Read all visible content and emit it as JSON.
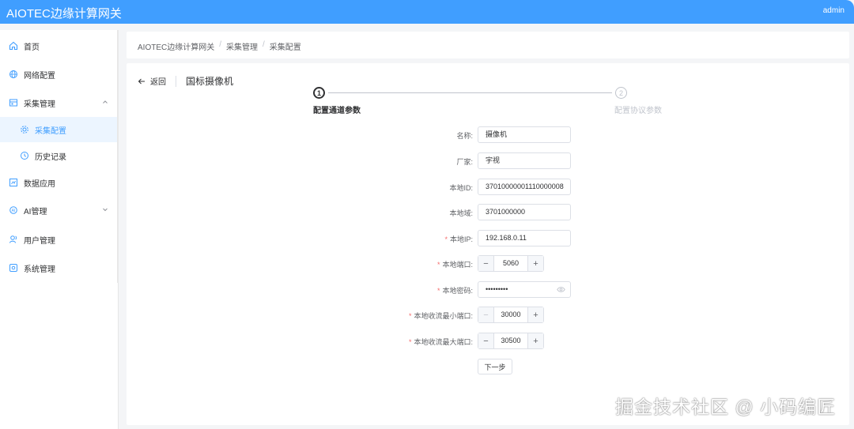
{
  "app": {
    "title": "AIOTEC边缘计算网关",
    "user": "admin"
  },
  "sidebar": {
    "items": [
      {
        "label": "首页",
        "icon": "home-icon"
      },
      {
        "label": "网络配置",
        "icon": "globe-icon"
      },
      {
        "label": "采集管理",
        "icon": "collect-icon",
        "expanded": true
      },
      {
        "label": "采集配置",
        "icon": "config-icon",
        "active": true
      },
      {
        "label": "历史记录",
        "icon": "history-icon"
      },
      {
        "label": "数据应用",
        "icon": "data-icon"
      },
      {
        "label": "AI管理",
        "icon": "ai-icon",
        "expanded": false
      },
      {
        "label": "用户管理",
        "icon": "user-icon"
      },
      {
        "label": "系统管理",
        "icon": "system-icon"
      }
    ]
  },
  "breadcrumb": [
    "AIOTEC边缘计算网关",
    "采集管理",
    "采集配置"
  ],
  "page": {
    "back_label": "返回",
    "title": "国标摄像机"
  },
  "steps": [
    {
      "number": "1",
      "title": "配置通道参数",
      "status": "process"
    },
    {
      "number": "2",
      "title": "配置协议参数",
      "status": "wait"
    }
  ],
  "form": {
    "name": {
      "label": "名称:",
      "value": "摄像机"
    },
    "vendor": {
      "label": "厂家:",
      "value": "宇视"
    },
    "local_id": {
      "label": "本地ID:",
      "value": "37010000001110000008"
    },
    "local_domain": {
      "label": "本地域:",
      "value": "3701000000"
    },
    "local_ip": {
      "label": "本地IP:",
      "value": "192.168.0.11",
      "required": "*"
    },
    "local_port": {
      "label": "本地端口:",
      "value": "5060",
      "required": "*"
    },
    "local_password": {
      "label": "本地密码:",
      "value": "•••••••••",
      "required": "*"
    },
    "min_port": {
      "label": "本地收流最小端口:",
      "value": "30000",
      "required": "*"
    },
    "max_port": {
      "label": "本地收流最大端口:",
      "value": "30500",
      "required": "*"
    },
    "next_label": "下一步"
  },
  "stepper_symbols": {
    "minus": "−",
    "plus": "+"
  },
  "watermark": "掘金技术社区 @ 小码编匠",
  "colors": {
    "primary": "#409eff",
    "required": "#f56c6c"
  }
}
